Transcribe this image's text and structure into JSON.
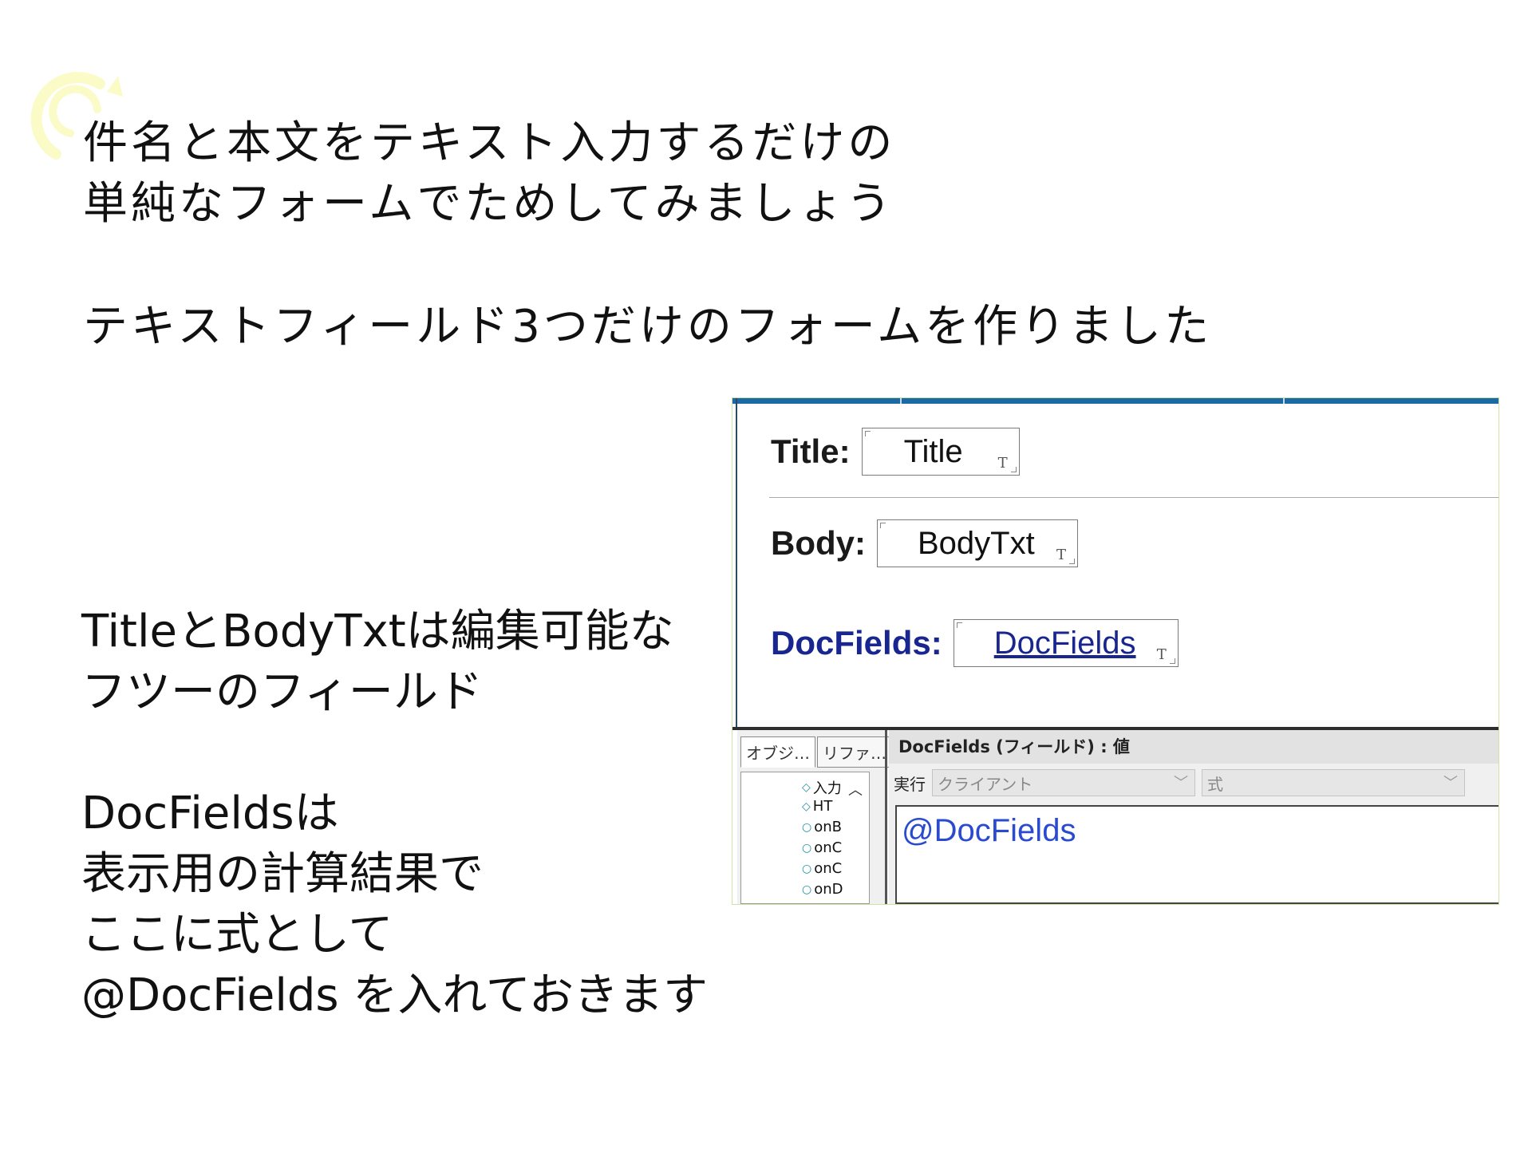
{
  "slide": {
    "heading": "件名と本文をテキスト入力するだけの\n単純なフォームでためしてみましょう",
    "subheading": "テキストフィールド3つだけのフォームを作りました",
    "note1": "TitleとBodyTxtは編集可能な\nフツーのフィールド",
    "note2": "DocFieldsは\n表示用の計算結果で\nここに式として\n @DocFields を入れておきます"
  },
  "form": {
    "title_label": "Title:",
    "title_field": "Title",
    "body_label": "Body:",
    "body_field": "BodyTxt",
    "docfields_label": "DocFields:",
    "docfields_field": "DocFields",
    "text_type_mark": "T"
  },
  "designer": {
    "tabs": [
      "オブジ…",
      "リファ…"
    ],
    "tree_items": [
      {
        "icon": "diamond-icon",
        "label": "入力"
      },
      {
        "icon": "diamond-icon",
        "label": "HT"
      },
      {
        "icon": "circle-icon",
        "label": "onB"
      },
      {
        "icon": "circle-icon",
        "label": "onC"
      },
      {
        "icon": "circle-icon",
        "label": "onC"
      },
      {
        "icon": "circle-icon",
        "label": "onD"
      }
    ],
    "header": "DocFields (フィールド) : 値",
    "run_label": "実行",
    "client_select": "クライアント",
    "formula_select": "式",
    "formula": "@DocFields"
  },
  "colors": {
    "accent_bar": "#1b6aa5",
    "link_blue": "#1a2690",
    "formula_blue": "#2a4ad0",
    "logo_yellow": "#fafad2"
  }
}
